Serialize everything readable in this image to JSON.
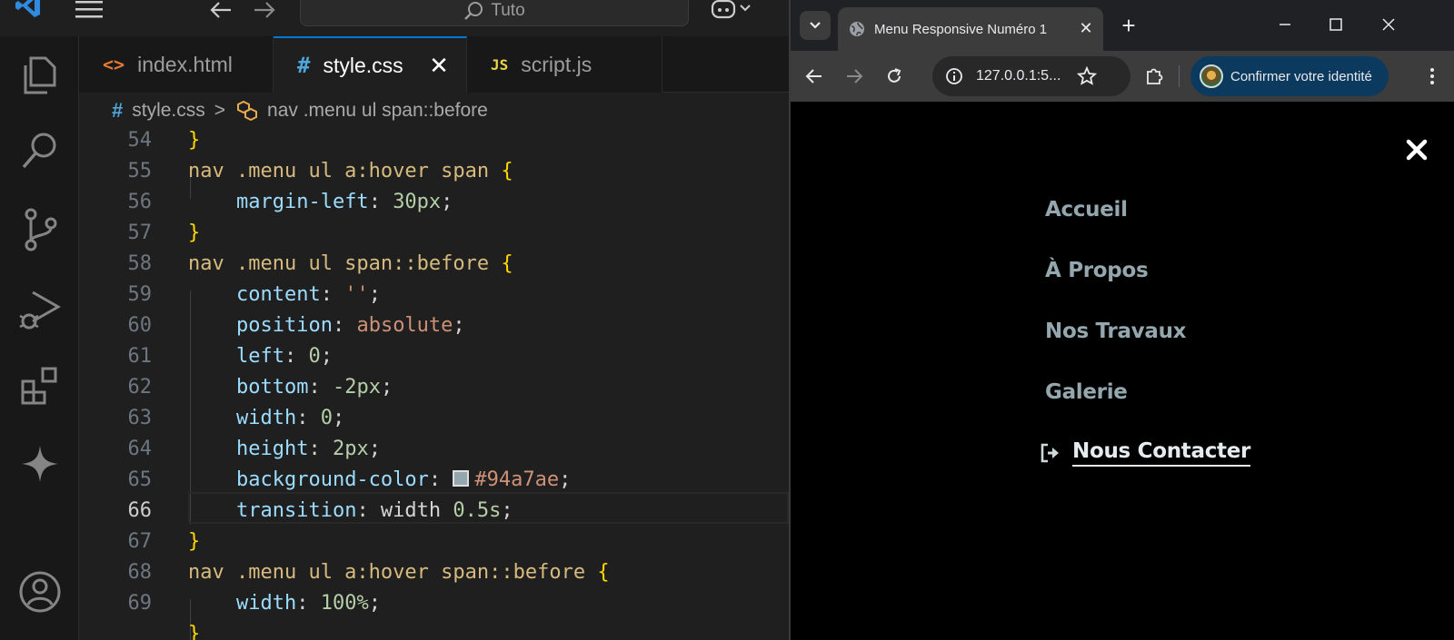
{
  "vscode": {
    "search_text": "Tuto",
    "tabs": [
      {
        "icon": "<>",
        "label": "index.html"
      },
      {
        "icon": "#",
        "label": "style.css"
      },
      {
        "icon": "JS",
        "label": "script.js"
      }
    ],
    "breadcrumb": {
      "file": "style.css",
      "separator": ">",
      "symbol": "nav .menu ul span::before"
    },
    "current_line": 66,
    "lines": [
      {
        "n": "54",
        "code": "}"
      },
      {
        "n": "55",
        "code": "nav .menu ul a:hover span {"
      },
      {
        "n": "56",
        "code": "    margin-left: 30px;"
      },
      {
        "n": "57",
        "code": "}"
      },
      {
        "n": "58",
        "code": "nav .menu ul span::before {"
      },
      {
        "n": "59",
        "code": "    content: '';"
      },
      {
        "n": "60",
        "code": "    position: absolute;"
      },
      {
        "n": "61",
        "code": "    left: 0;"
      },
      {
        "n": "62",
        "code": "    bottom: -2px;"
      },
      {
        "n": "63",
        "code": "    width: 0;"
      },
      {
        "n": "64",
        "code": "    height: 2px;"
      },
      {
        "n": "65",
        "code": "    background-color: #94a7ae;"
      },
      {
        "n": "66",
        "code": "    transition: width 0.5s;"
      },
      {
        "n": "67",
        "code": "}"
      },
      {
        "n": "68",
        "code": "nav .menu ul a:hover span::before {"
      },
      {
        "n": "69",
        "code": "    width: 100%;"
      }
    ],
    "swatch_color": "#94a7ae"
  },
  "chrome": {
    "tab_title": "Menu Responsive Numéro 1",
    "url": "127.0.0.1:5...",
    "profile_label": "Confirmer votre identité",
    "menu": {
      "items": [
        "Accueil",
        "À Propos",
        "Nos Travaux",
        "Galerie"
      ],
      "contact": "Nous Contacter",
      "link_color": "#94a7ae"
    }
  }
}
